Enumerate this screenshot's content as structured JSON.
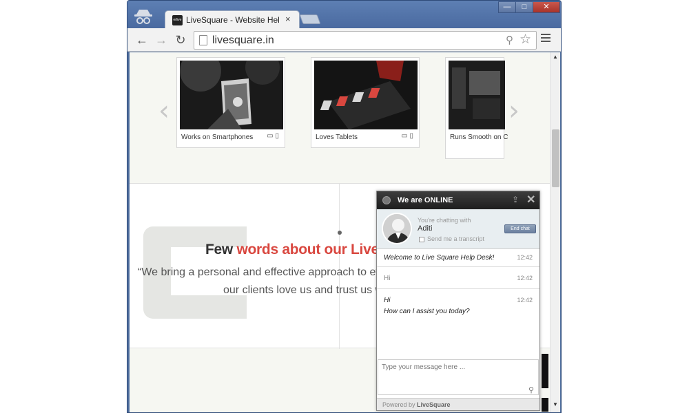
{
  "browser": {
    "tab_title": "LiveSquare - Website HelpDe",
    "tab_favicon_text": "erlive",
    "tab_close": "×",
    "url": "livesquare.in",
    "controls": {
      "minimize": "—",
      "maximize": "□",
      "close": "✕"
    },
    "icons": {
      "back": "back-arrow-icon",
      "forward": "forward-arrow-icon",
      "reload": "reload-icon",
      "search": "search-icon",
      "star": "star-icon",
      "menu": "hamburger-menu-icon",
      "incognito": "incognito-icon"
    }
  },
  "carousel": {
    "prev": "‹",
    "next": "›",
    "cards": [
      {
        "caption": "Works on Smartphones",
        "devices": "▭ ▯"
      },
      {
        "caption": "Loves Tablets",
        "devices": "▭ ▯"
      },
      {
        "caption": "Runs Smooth on C"
      }
    ]
  },
  "about": {
    "heading_plain": "Few ",
    "heading_highlight": "words about our Live Sq",
    "quote_line1": "“We bring a personal and effective approach to every",
    "quote_line2": "our clients love us and trust us wi"
  },
  "chat": {
    "header_title": "We are ONLINE",
    "popout_icon": "⇪",
    "close_icon": "✕",
    "chatting_with_label": "You're chatting with",
    "agent_name": "Aditi",
    "end_chat_label": "End chat",
    "transcript_label": "Send me a transcript",
    "messages": [
      {
        "text": "Welcome to Live Square Help Desk!",
        "time": "12:42"
      },
      {
        "text": "Hi",
        "time": "12:42"
      },
      {
        "text": "Hi",
        "text2": "How can I assist you today?",
        "time": "12:42"
      }
    ],
    "input_placeholder": "Type your message here ...",
    "attach_icon": "paperclip-icon",
    "powered_prefix": "Powered by ",
    "powered_brand": "LiveSquare"
  },
  "colors": {
    "accent_red": "#d9473f",
    "window_frame": "#4f6e9e",
    "chat_header": "#1e1e1e"
  }
}
